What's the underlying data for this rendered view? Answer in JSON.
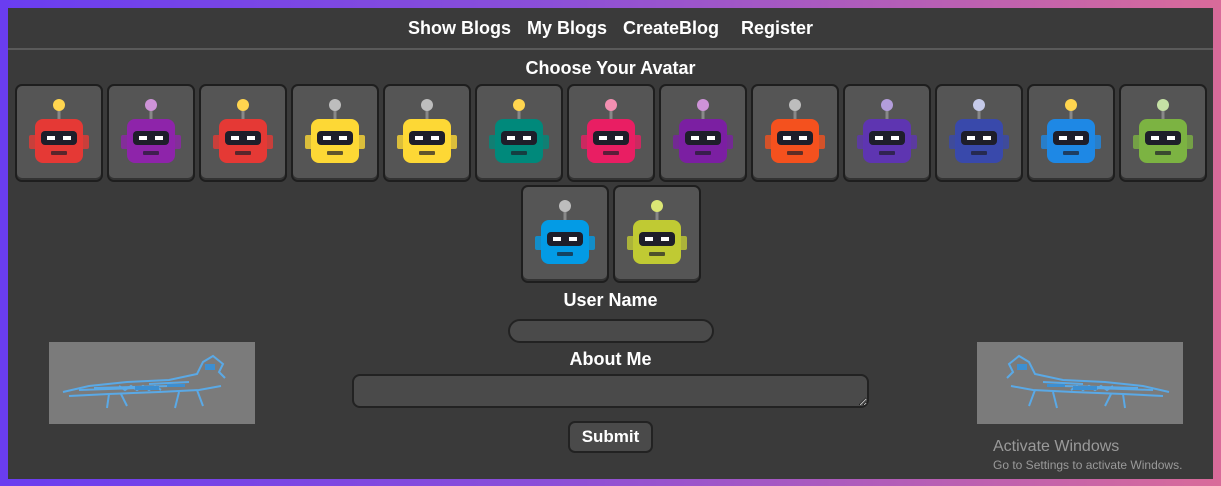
{
  "nav": {
    "items": [
      "Show Blogs",
      "My Blogs",
      "CreateBlog",
      "Register"
    ]
  },
  "avatar_section": {
    "title": "Choose Your Avatar",
    "avatars": [
      {
        "name": "robot-red-hearts-icon",
        "color": "#e53935",
        "antenna": "#ffd54f"
      },
      {
        "name": "robot-purple-visor-icon",
        "color": "#8e24aa",
        "antenna": "#ce93d8"
      },
      {
        "name": "robot-red-visor-icon",
        "color": "#e53935",
        "antenna": "#ffd54f"
      },
      {
        "name": "robot-yellow-goggles-icon",
        "color": "#fdd835",
        "antenna": "#bdbdbd"
      },
      {
        "name": "robot-yellow-x-eyes-icon",
        "color": "#fdd835",
        "antenna": "#bdbdbd"
      },
      {
        "name": "robot-teal-icon",
        "color": "#00897b",
        "antenna": "#ffd54f"
      },
      {
        "name": "robot-pink-icon",
        "color": "#e91e63",
        "antenna": "#f48fb1"
      },
      {
        "name": "robot-purple-grin-icon",
        "color": "#7b1fa2",
        "antenna": "#ce93d8"
      },
      {
        "name": "robot-orange-monocle-icon",
        "color": "#f4511e",
        "antenna": "#bdbdbd"
      },
      {
        "name": "robot-violet-shades-icon",
        "color": "#5e35b1",
        "antenna": "#b39ddb"
      },
      {
        "name": "robot-indigo-shades-icon",
        "color": "#3949ab",
        "antenna": "#c5cae9"
      },
      {
        "name": "robot-blue-goggles-icon",
        "color": "#1e88e5",
        "antenna": "#ffd54f"
      },
      {
        "name": "robot-green-visor-icon",
        "color": "#7cb342",
        "antenna": "#c5e1a5"
      },
      {
        "name": "robot-sky-visor-icon",
        "color": "#039be5",
        "antenna": "#bdbdbd"
      },
      {
        "name": "robot-lime-eyes-icon",
        "color": "#c0ca33",
        "antenna": "#dce775"
      }
    ]
  },
  "form": {
    "username_label": "User Name",
    "username_value": "",
    "about_label": "About Me",
    "about_value": "",
    "submit_label": "Submit"
  },
  "watermark": {
    "line1": "Activate Windows",
    "line2": "Go to Settings to activate Windows."
  }
}
